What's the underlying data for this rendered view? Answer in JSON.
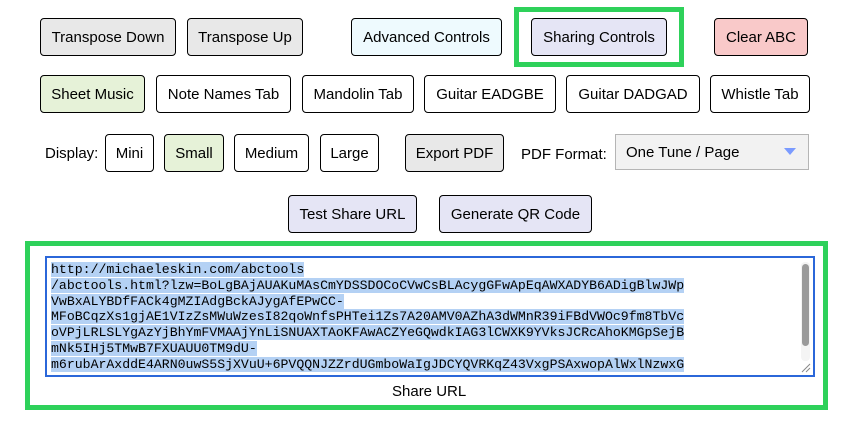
{
  "row1": {
    "transpose_down": "Transpose Down",
    "transpose_up": "Transpose Up",
    "advanced_controls": "Advanced Controls",
    "sharing_controls": "Sharing Controls",
    "clear_abc": "Clear ABC"
  },
  "row2": {
    "sheet_music": "Sheet Music",
    "note_names_tab": "Note Names Tab",
    "mandolin_tab": "Mandolin Tab",
    "guitar_eadgbe": "Guitar EADGBE",
    "guitar_dadgad": "Guitar DADGAD",
    "whistle_tab": "Whistle Tab"
  },
  "row3": {
    "display_label": "Display:",
    "mini": "Mini",
    "small": "Small",
    "medium": "Medium",
    "large": "Large",
    "export_pdf": "Export PDF",
    "pdf_format_label": "PDF Format:",
    "pdf_format_value": "One Tune / Page"
  },
  "row4": {
    "test_share_url": "Test Share URL",
    "generate_qr_code": "Generate QR Code"
  },
  "share": {
    "url_lines": [
      "http://michaeleskin.com/abctools",
      "/abctools.html?lzw=BoLgBAjAUAKuMAsCmYDSSDOCoCVwCsBLAcygGFwApEqAWXADYB6ADigBlwJWp",
      "VwBxALYBDfFACk4gMZIAdgBckAJygAfEPwCC-",
      "MFoBCqzXs1gjAE1VIzZsMWuWzesI82qoWnfsPHTei1Zs7A20AMV0AZhA3dWMnR39iFBdVWOc9fm8TbVc",
      "oVPjLRLSLYgAzYjBhYmFVMAAjYnLiSNUAXTAoKFAwACZYeGQwdkIAG3lCWXK9YVksJCRcAhoKMGpSejB",
      "mNk5IHj5TMwB7FXUAUU0TM9dU-",
      "m6rubArAxddE4ARN0uwS5SjXVuU+6PVQQNJZZrdUGmboWaIgJDCYQVRKqZ43VxgPSAxwopAlWxlNzwxG"
    ],
    "label": "Share URL"
  },
  "colors": {
    "highlight_green": "#2ed15a",
    "textarea_border": "#2b67d9",
    "selection": "#b4d1f4",
    "clear_button": "#f9c9c9",
    "selected_button": "#e6f2d8",
    "control_button": "#e5e5f5"
  }
}
